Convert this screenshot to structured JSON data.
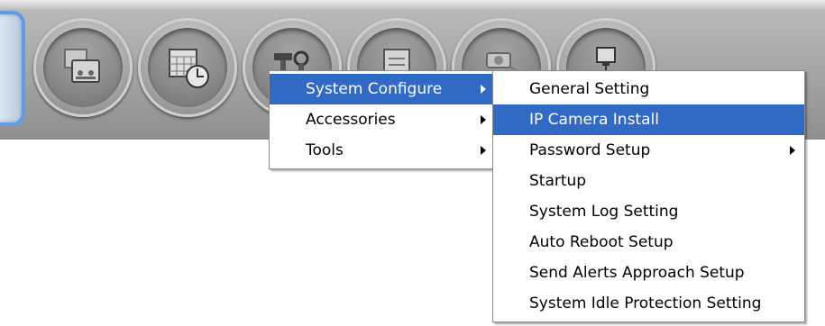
{
  "toolbar": {
    "buttons": [
      {
        "icon": "playback-icon"
      },
      {
        "icon": "schedule-clock-icon"
      },
      {
        "icon": "tools-icon"
      },
      {
        "icon": "report-icon"
      },
      {
        "icon": "ptz-camera-icon"
      },
      {
        "icon": "network-icon"
      }
    ]
  },
  "main_menu": {
    "items": [
      {
        "label": "System Configure",
        "has_submenu": true,
        "highlighted": true
      },
      {
        "label": "Accessories",
        "has_submenu": true,
        "highlighted": false
      },
      {
        "label": "Tools",
        "has_submenu": true,
        "highlighted": false
      }
    ]
  },
  "submenu": {
    "items": [
      {
        "label": "General Setting",
        "has_submenu": false,
        "highlighted": false
      },
      {
        "label": "IP Camera Install",
        "has_submenu": false,
        "highlighted": true
      },
      {
        "label": "Password Setup",
        "has_submenu": true,
        "highlighted": false
      },
      {
        "label": "Startup",
        "has_submenu": false,
        "highlighted": false
      },
      {
        "label": "System Log Setting",
        "has_submenu": false,
        "highlighted": false
      },
      {
        "label": "Auto Reboot Setup",
        "has_submenu": false,
        "highlighted": false
      },
      {
        "label": "Send Alerts Approach Setup",
        "has_submenu": false,
        "highlighted": false
      },
      {
        "label": "System Idle Protection Setting",
        "has_submenu": false,
        "highlighted": false
      }
    ]
  },
  "colors": {
    "highlight": "#316ac5",
    "toolbar": "#a8a8a8",
    "side_tab_border": "#5d9de6"
  }
}
